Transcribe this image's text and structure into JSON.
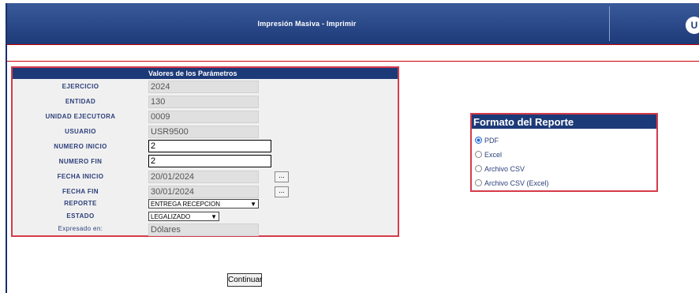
{
  "header": {
    "title": "Impresión Masiva - Imprimir",
    "logo_text": "U"
  },
  "params": {
    "title": "Valores de los Parámetros",
    "rows": [
      {
        "label": "EJERCICIO",
        "value": "2024"
      },
      {
        "label": "ENTIDAD",
        "value": "130"
      },
      {
        "label": "UNIDAD EJECUTORA",
        "value": "0009"
      },
      {
        "label": "USUARIO",
        "value": "USR9500"
      },
      {
        "label": "NUMERO INICIO",
        "value": "2"
      },
      {
        "label": "NUMERO FIN",
        "value": "2"
      },
      {
        "label": "FECHA INICIO",
        "value": "20/01/2024",
        "button": "..."
      },
      {
        "label": "FECHA FIN",
        "value": "30/01/2024",
        "button": "..."
      },
      {
        "label": "REPORTE",
        "value": "ENTREGA RECEPCION"
      },
      {
        "label": "ESTADO",
        "value": "LEGALIZADO"
      },
      {
        "label": "Expresado en:",
        "value": "Dólares"
      }
    ]
  },
  "format": {
    "title": "Formato del Reporte",
    "options": [
      {
        "label": "PDF",
        "selected": true
      },
      {
        "label": "Excel",
        "selected": false
      },
      {
        "label": "Archivo CSV",
        "selected": false
      },
      {
        "label": "Archivo CSV (Excel)",
        "selected": false
      }
    ]
  },
  "actions": {
    "continue_label": "Continuar"
  },
  "colors": {
    "header": "#1d3a78",
    "border_accent": "#d63a4a",
    "radio_selected": "#1e6ad8"
  }
}
